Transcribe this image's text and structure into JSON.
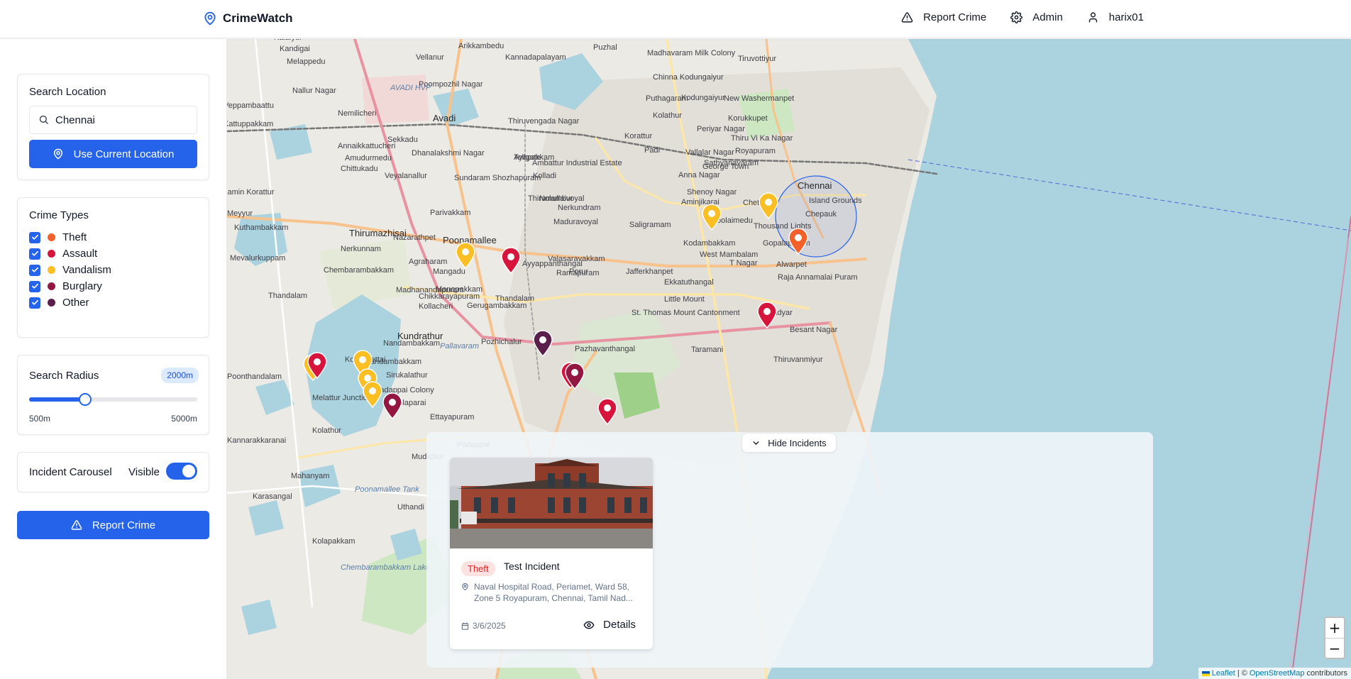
{
  "app": {
    "title": "CrimeWatch"
  },
  "nav": {
    "report_crime": "Report Crime",
    "admin": "Admin",
    "user": "harix01"
  },
  "sidebar": {
    "search": {
      "title": "Search Location",
      "value": "Chennai",
      "use_location_label": "Use Current Location"
    },
    "crime_types": {
      "title": "Crime Types",
      "items": [
        {
          "label": "Theft",
          "color": "#f4602a",
          "checked": true
        },
        {
          "label": "Assault",
          "color": "#d6143c",
          "checked": true
        },
        {
          "label": "Vandalism",
          "color": "#fbbf24",
          "checked": true
        },
        {
          "label": "Burglary",
          "color": "#931741",
          "checked": true
        },
        {
          "label": "Other",
          "color": "#5b1f4b",
          "checked": true
        }
      ]
    },
    "radius": {
      "title": "Search Radius",
      "value_label": "2000m",
      "value": 2000,
      "min": 500,
      "max": 5000,
      "min_label": "500m",
      "max_label": "5000m"
    },
    "carousel": {
      "title": "Incident Carousel",
      "state_label": "Visible",
      "enabled": true
    },
    "report_button": "Report Crime"
  },
  "map": {
    "labels": [
      "Kalaiyur",
      "Kandigai",
      "Melappedu",
      "Vellanur",
      "Arikkambedu",
      "Kannadapalayam",
      "Puzhal",
      "Madhavaram Milk Colony",
      "Tiruvottiyur",
      "Nallur Nagar",
      "Poompozhil Nagar",
      "AVADI HVF",
      "Chinna Kodungaiyur",
      "Veppambaattu",
      "Nemilicheri",
      "Puthagaram",
      "Kodungaiyur",
      "New Washermanpet",
      "Avadi",
      "Thiruvengada Nagar",
      "Kolathur",
      "Korukkupet",
      "Kattuppakkam",
      "Sekkadu",
      "Korattur",
      "Periyar Nagar",
      "Thiru Vi Ka Nagar",
      "Royapuram",
      "Annaikkattucheri",
      "Dhanalakshmi Nagar",
      "Ayapakkam",
      "Tollgate",
      "Ambattur Industrial Estate",
      "Padi",
      "Amudurmedu",
      "Chittukadu",
      "Veyalanallur",
      "Kolladi",
      "Sathyanavaram",
      "Vallalar Nagar",
      "George Town",
      "Sundaram Shozhapuram",
      "Anna Nagar",
      "Chennai",
      "Island Grounds",
      "Poonamallee",
      "Jamin Korattur",
      "Thirumullaivoyal",
      "Nolambur",
      "Shenoy Nagar",
      "Meyyur",
      "Parivakkam",
      "Nerkundram",
      "Aminjikarai",
      "Chetpet",
      "Chepauk",
      "Kuthambakkam",
      "Thirumazhisai",
      "Maduravoyal",
      "Choolaimedu",
      "Saligramam",
      "Thousand Lights",
      "Nerkunnam",
      "Nazarathpet",
      "Kodambakkam",
      "Gopalapuram",
      "Mevalurkuppam",
      "Chembarambakkam",
      "Agraharam",
      "Mangadu",
      "Valasaravakkam",
      "West Mambalam",
      "T Nagar",
      "Alwarpet",
      "Ayyappanthangal",
      "Porur",
      "Ramapuram",
      "Jafferkhanpet",
      "Raja Annamalai Puram",
      "Thandalam",
      "Madhanandapuram",
      "Ekkatuthangal",
      "Manapakkam",
      "Chikkarayapuram",
      "Nandambakkam",
      "Little Mount",
      "Gerugambakkam",
      "St. Thomas Mount Cantonment",
      "Adyar",
      "Kollacheri",
      "Thandalam",
      "Besant Nagar",
      "Kundrathur",
      "Pozhichalur",
      "Pallavaram",
      "Pazhavanthangal",
      "Taramani",
      "Kolattipettai",
      "Thiruvanmiyur",
      "Nandambakkam",
      "Sirukalathur",
      "Kolaparai",
      "Padappai Colony",
      "Poonthandalam",
      "Melattur Junction",
      "Ettayapuram",
      "Kolathur",
      "Kannarakkaranai",
      "Mahanyam",
      "Mudichur",
      "Karasangal",
      "Padappai",
      "Kolapakkam",
      "Uthandi",
      "Chembarambakkam Lake",
      "Poonamallee Tank",
      "India"
    ],
    "zoom_in": "+",
    "zoom_out": "−",
    "attribution": {
      "leaflet": "Leaflet",
      "sep": "| ©",
      "osm": "OpenStreetMap",
      "suffix": "contributors"
    },
    "markers": [
      {
        "type": "Vandalism",
        "color": "#fbbf24"
      },
      {
        "type": "Assault",
        "color": "#d6143c"
      },
      {
        "type": "Vandalism",
        "color": "#fbbf24"
      },
      {
        "type": "Vandalism",
        "color": "#fbbf24"
      },
      {
        "type": "Theft",
        "color": "#f4602a"
      },
      {
        "type": "Assault",
        "color": "#d6143c"
      },
      {
        "type": "Other",
        "color": "#5b1f4b"
      },
      {
        "type": "Assault",
        "color": "#d6143c"
      },
      {
        "type": "Vandalism",
        "color": "#fbbf24"
      },
      {
        "type": "Vandalism",
        "color": "#fbbf24"
      },
      {
        "type": "Vandalism",
        "color": "#fbbf24"
      },
      {
        "type": "Burglary",
        "color": "#931741"
      },
      {
        "type": "Assault",
        "color": "#d6143c"
      },
      {
        "type": "Vandalism",
        "color": "#fbbf24"
      },
      {
        "type": "Burglary",
        "color": "#931741"
      },
      {
        "type": "Assault",
        "color": "#d6143c"
      }
    ]
  },
  "incidents": {
    "hide_label": "Hide Incidents",
    "items": [
      {
        "type": "Theft",
        "title": "Test Incident",
        "address": "Naval Hospital Road, Periamet, Ward 58, Zone 5 Royapuram, Chennai, Tamil Nad...",
        "date": "3/6/2025",
        "details_label": "Details"
      }
    ]
  }
}
